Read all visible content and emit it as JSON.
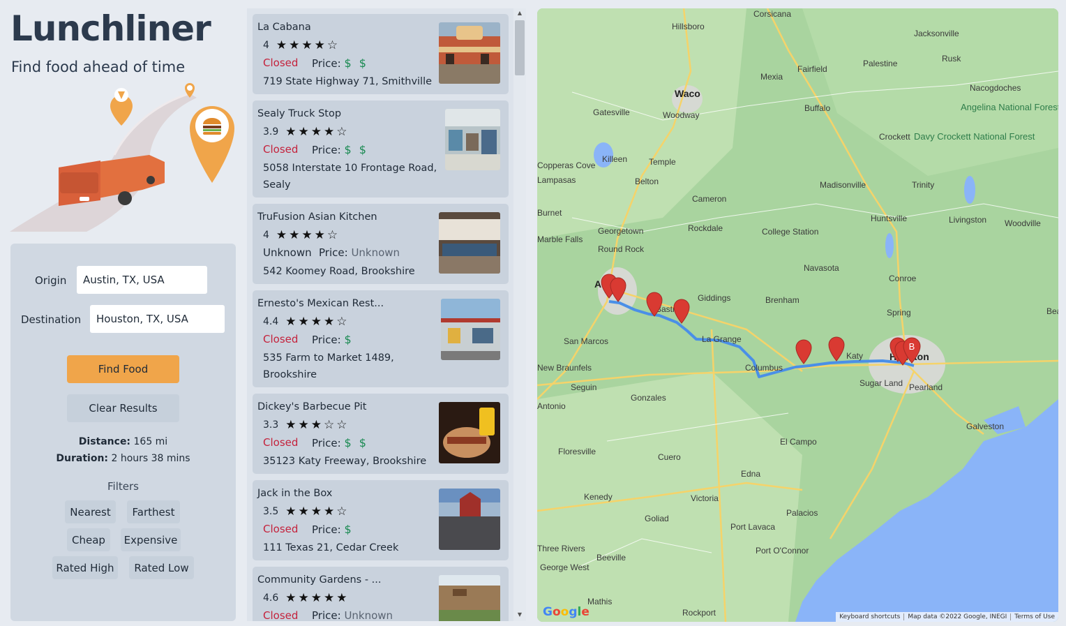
{
  "app": {
    "title": "Lunchliner",
    "subtitle": "Find food ahead of time"
  },
  "form": {
    "origin_label": "Origin",
    "origin_value": "Austin, TX, USA",
    "destination_label": "Destination",
    "destination_value": "Houston, TX, USA",
    "find_button": "Find Food",
    "clear_button": "Clear Results",
    "distance_label": "Distance:",
    "distance_value": "165 mi",
    "duration_label": "Duration:",
    "duration_value": "2 hours 38 mins",
    "filters_title": "Filters",
    "filters": [
      "Nearest",
      "Farthest",
      "Cheap",
      "Expensive",
      "Rated High",
      "Rated Low"
    ]
  },
  "price_label": "Price:",
  "results": [
    {
      "name": "La Cabana",
      "rating": "4",
      "stars": "★★★★☆",
      "status": "Closed",
      "price": "$ $",
      "address": "719 State Highway 71, Smithville",
      "thumb_color": "#8b5a3c"
    },
    {
      "name": "Sealy Truck Stop",
      "rating": "3.9",
      "stars": "★★★★☆",
      "status": "Closed",
      "price": "$ $",
      "address": "5058 Interstate 10 Frontage Road, Sealy",
      "thumb_color": "#7c8a8f"
    },
    {
      "name": "TruFusion Asian Kitchen",
      "rating": "4",
      "stars": "★★★★☆",
      "status": "Unknown",
      "price": "Unknown",
      "address": "542 Koomey Road, Brookshire",
      "thumb_color": "#6e5a4a"
    },
    {
      "name": "Ernesto's Mexican Rest...",
      "rating": "4.4",
      "stars": "★★★★☆",
      "status": "Closed",
      "price": "$",
      "address": "535 Farm to Market 1489, Brookshire",
      "thumb_color": "#7a9bb8"
    },
    {
      "name": "Dickey's Barbecue Pit",
      "rating": "3.3",
      "stars": "★★★☆☆",
      "status": "Closed",
      "price": "$ $",
      "address": "35123 Katy Freeway, Brookshire",
      "thumb_color": "#5a3020"
    },
    {
      "name": "Jack in the Box",
      "rating": "3.5",
      "stars": "★★★★☆",
      "status": "Closed",
      "price": "$",
      "address": "111 Texas 21, Cedar Creek",
      "thumb_color": "#5b7fa8"
    },
    {
      "name": "Community Gardens - ...",
      "rating": "4.6",
      "stars": "★★★★★",
      "status": "Closed",
      "price": "Unknown",
      "address": "",
      "thumb_color": "#9a8a6a"
    }
  ],
  "map": {
    "cities": [
      "Corsicana",
      "Hillsboro",
      "Jacksonville",
      "Waco",
      "Mexia",
      "Fairfield",
      "Palestine",
      "Rusk",
      "Nacogdoches",
      "Buffalo",
      "Gatesville",
      "Woodway",
      "Angelina National Forest",
      "Davy Crockett National Forest",
      "Crockett",
      "Killeen",
      "Temple",
      "Copperas Cove",
      "Lampasas",
      "Belton",
      "Madisonville",
      "Trinity",
      "Cameron",
      "Burnet",
      "Georgetown",
      "Rockdale",
      "College Station",
      "Huntsville",
      "Livingston",
      "Woodville",
      "Marble Falls",
      "Round Rock",
      "Navasota",
      "Conroe",
      "Austin",
      "Giddings",
      "Bastrop",
      "Brenham",
      "Spring",
      "San Marcos",
      "La Grange",
      "Katy",
      "Houston",
      "New Braunfels",
      "Columbus",
      "Sugar Land",
      "Pearland",
      "Seguin",
      "Gonzales",
      "Galveston",
      "El Campo",
      "Floresville",
      "Cuero",
      "Edna",
      "Kenedy",
      "Victoria",
      "Goliad",
      "Palacios",
      "Port Lavaca",
      "Three Rivers",
      "Beeville",
      "Port O'Connor",
      "George West",
      "Mathis",
      "Rockport",
      "Beaumont",
      "Antonio"
    ],
    "attribution": [
      "Keyboard shortcuts",
      "Map data ©2022 Google, INEGI",
      "Terms of Use"
    ],
    "logo": "Google",
    "destination_marker": "B"
  }
}
